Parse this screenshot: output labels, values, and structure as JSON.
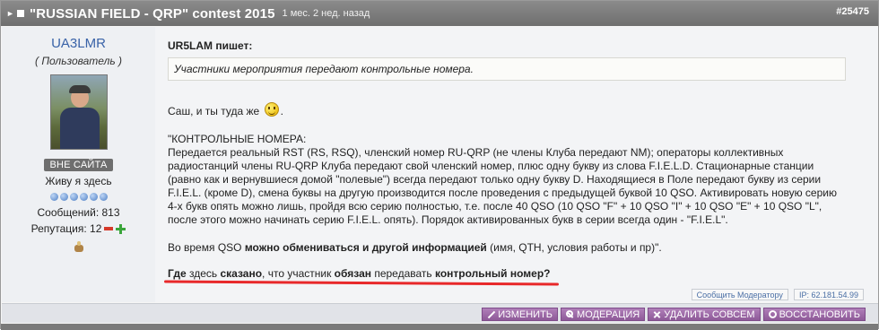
{
  "post": {
    "title": "\"RUSSIAN FIELD - QRP\" contest 2015",
    "ago": "1 мес. 2 нед. назад",
    "post_id": "#25475"
  },
  "author": {
    "name": "UA3LMR",
    "role": "( Пользователь )",
    "status": "ВНЕ САЙТА",
    "location": "Живу я здесь",
    "messages": "Сообщений: 813",
    "reputation": "Репутация: 12",
    "rank_dots": 6
  },
  "content": {
    "quote_author": "UR5LAM пишет:",
    "quote_text": "Участники мероприятия передают контрольные номера.",
    "reply_before_smiley": "Саш, и ты туда же",
    "reply_after_smiley": ".",
    "block_heading": "\"КОНТРОЛЬНЫЕ НОМЕРА:",
    "block_lines": [
      "Передается реальный RST (RS, RSQ), членский номер RU-QRP (не члены Клуба передают NM); операторы коллективных",
      "радиостанций члены RU-QRP Клуба передают свой членский номер, плюс одну букву из слова F.I.E.L.D. Стационарные станции",
      "(равно как и вернувшиеся домой \"полевые\") всегда передают только одну букву D. Находящиеся в Поле передают букву из серии",
      "F.I.E.L. (кроме D), смена буквы на другую производится после проведения с предыдущей буквой 10 QSO. Активировать новую серию",
      "4-х букв опять можно лишь, пройдя всю серию полностью, т.е. после 40 QSO (10 QSO \"F\" + 10 QSO \"I\" + 10 QSO \"E\" + 10 QSO \"L\",",
      "после этого можно начинать серию F.I.E.L. опять). Порядок активированных букв в серии всегда один - \"F.I.E.L\"."
    ],
    "info_prefix": "Во время QSO ",
    "info_bold": "можно обмениваться и другой информацией",
    "info_suffix": " (имя, QTH, условия работы и пр)\".",
    "question_parts": [
      {
        "text": "Где",
        "bold": true
      },
      {
        "text": " здесь ",
        "bold": false
      },
      {
        "text": "сказано",
        "bold": true
      },
      {
        "text": ", что участник ",
        "bold": false
      },
      {
        "text": "обязан",
        "bold": true
      },
      {
        "text": " передавать ",
        "bold": false
      },
      {
        "text": "контрольный номер?",
        "bold": true
      }
    ]
  },
  "meta": {
    "report": "Сообщить Модератору",
    "ip": "IP: 62.181.54.99"
  },
  "actions": {
    "edit": "ИЗМЕНИТЬ",
    "moderate": "МОДЕРАЦИЯ",
    "delete": "УДАЛИТЬ СОВСЕМ",
    "restore": "ВОССТАНОВИТЬ"
  },
  "colors": {
    "header": "#7a7a7a",
    "author_name": "#3a63a8",
    "action_button": "#9a68a5",
    "underline": "#e8282a",
    "rep_minus": "#d63a2a",
    "rep_plus": "#3aa53a"
  },
  "icons": [
    "collapse-arrow-icon",
    "square-icon",
    "smiley-icon",
    "rank-dot-icon",
    "award-icon",
    "pencil-icon",
    "wrench-icon",
    "x-icon",
    "restore-icon"
  ]
}
